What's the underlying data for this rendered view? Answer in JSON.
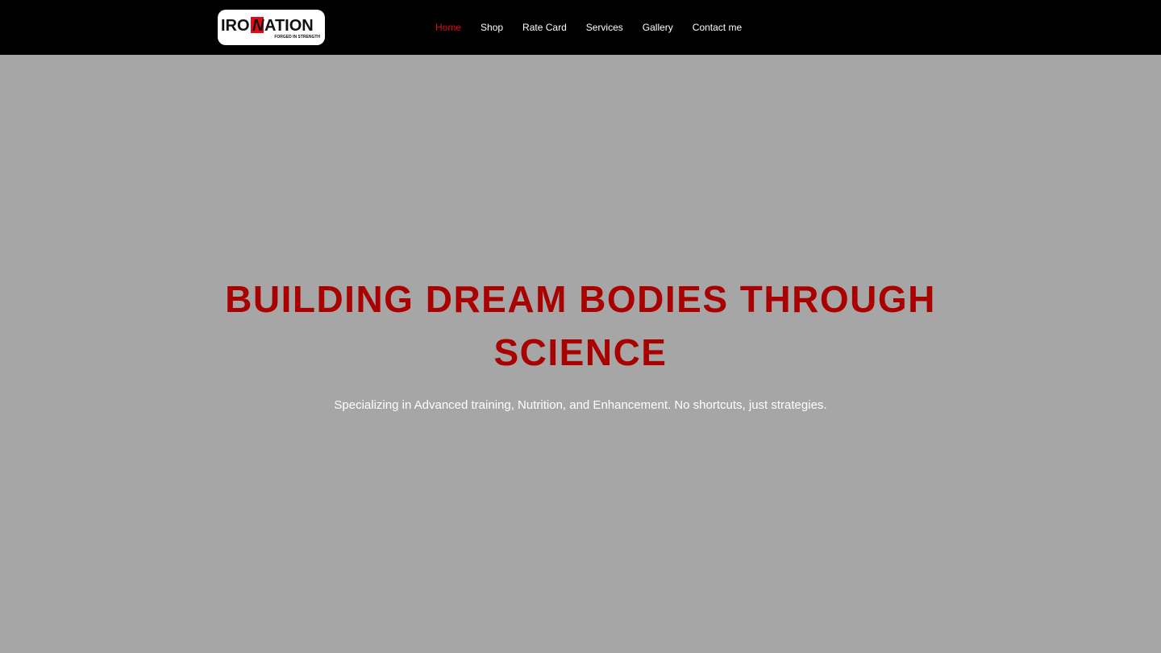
{
  "brand": {
    "logo_part1": "IRO",
    "logo_part2": "N",
    "logo_part3": "ATION",
    "logo_tagline": "FORGED IN STRENGTH",
    "accent_color": "#e50914"
  },
  "nav": {
    "items": [
      {
        "label": "Home",
        "active": true
      },
      {
        "label": "Shop",
        "active": false
      },
      {
        "label": "Rate Card",
        "active": false
      },
      {
        "label": "Services",
        "active": false
      },
      {
        "label": "Gallery",
        "active": false
      },
      {
        "label": "Contact me",
        "active": false
      }
    ]
  },
  "hero": {
    "title": "BUILDING DREAM BODIES THROUGH SCIENCE",
    "subtitle": "Specializing in Advanced training, Nutrition, and Enhancement. No shortcuts, just strategies.",
    "title_color": "#a90000",
    "background_color": "#a6a6a6"
  }
}
